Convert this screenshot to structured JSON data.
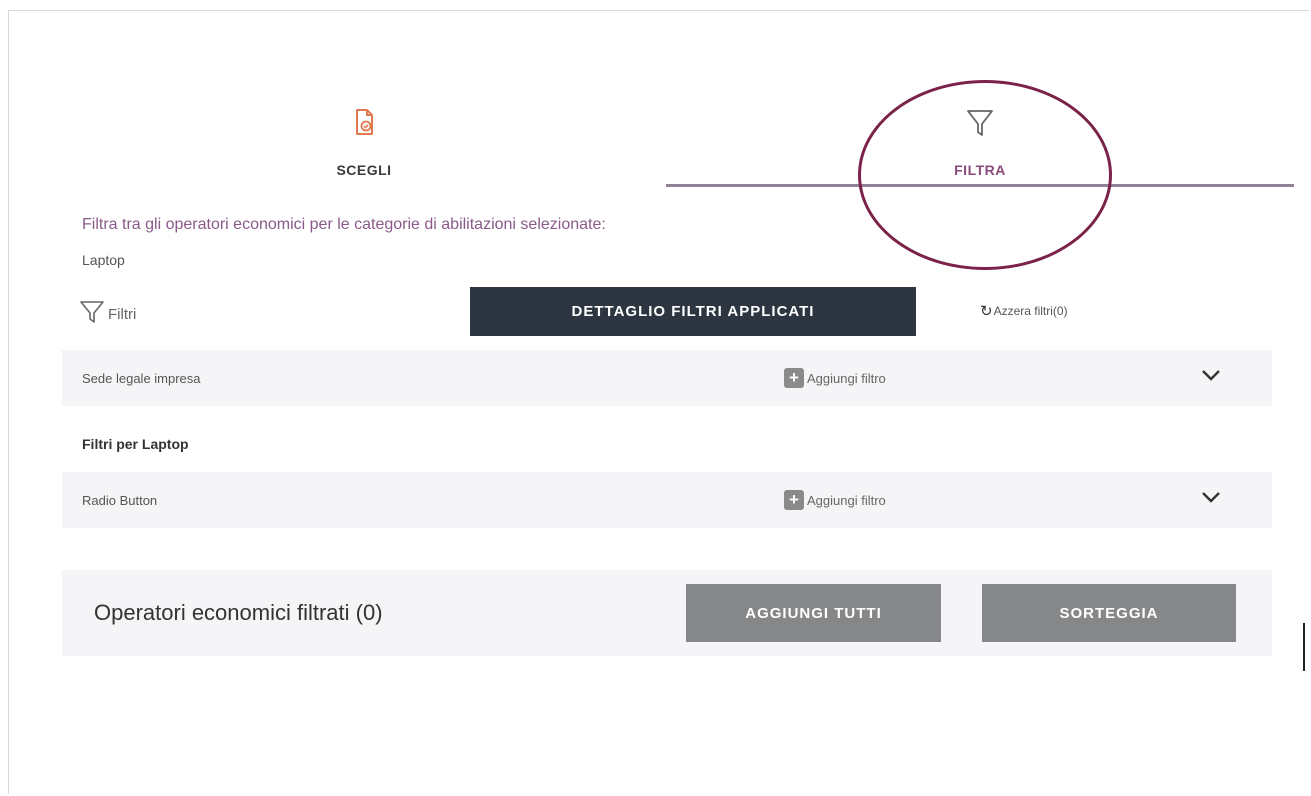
{
  "tabs": [
    {
      "label": "SCEGLI",
      "icon": "document-check-icon",
      "color": "#e07a4e"
    },
    {
      "label": "FILTRA",
      "icon": "funnel-icon"
    }
  ],
  "description": "Filtra tra gli operatori economici per le categorie di abilitazioni selezionate:",
  "category": "Laptop",
  "filters_label": "Filtri",
  "detail_button": "DETTAGLIO FILTRI APPLICATI",
  "reset_filters": "Azzera filtri(0)",
  "rows": [
    {
      "label": "Sede legale impresa",
      "add_label": "Aggiungi filtro"
    },
    {
      "label": "Radio Button",
      "add_label": "Aggiungi filtro"
    }
  ],
  "section_title": "Filtri per Laptop",
  "results": {
    "count_label": "Operatori economici filtrati (0)",
    "add_all_button": "AGGIUNGI TUTTI",
    "draw_button": "SORTEGGIA"
  },
  "colors": {
    "accent_purple": "#8a4a7a",
    "highlight_ring": "#7a2248",
    "dark_button": "#2d3540",
    "gray_button": "#858789"
  }
}
